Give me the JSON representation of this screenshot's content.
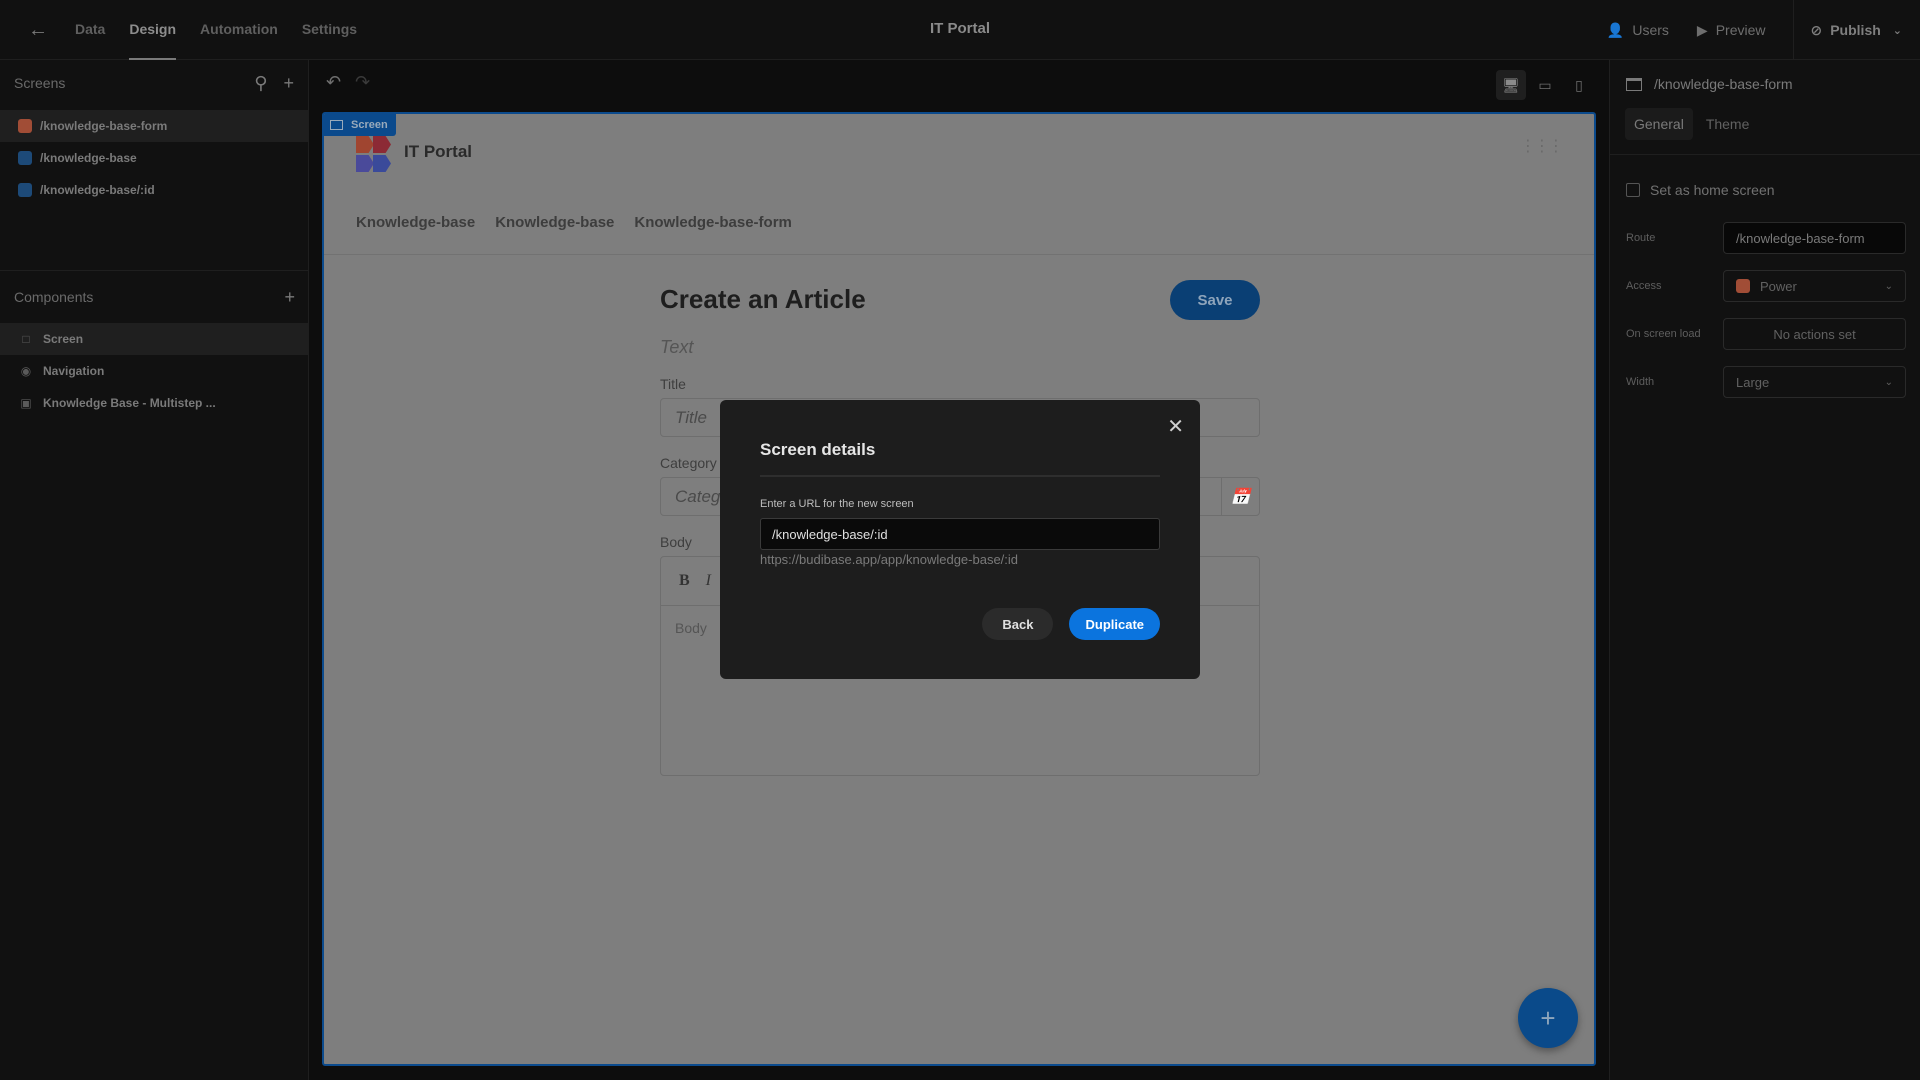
{
  "topbar": {
    "back_icon": "arrow-left-icon",
    "tabs": [
      {
        "label": "Data",
        "active": false
      },
      {
        "label": "Design",
        "active": true
      },
      {
        "label": "Automation",
        "active": false
      },
      {
        "label": "Settings",
        "active": false
      }
    ],
    "app_title": "IT Portal",
    "users_label": "Users",
    "preview_label": "Preview",
    "publish_label": "Publish"
  },
  "screens_panel": {
    "title": "Screens",
    "items": [
      {
        "route": "/knowledge-base-form",
        "color": "#a14d36",
        "selected": true
      },
      {
        "route": "/knowledge-base",
        "color": "#1d4a78",
        "selected": false
      },
      {
        "route": "/knowledge-base/:id",
        "color": "#1d4a78",
        "selected": false
      }
    ]
  },
  "components_panel": {
    "title": "Components",
    "items": [
      {
        "label": "Screen",
        "icon": "screen-icon",
        "selected": true
      },
      {
        "label": "Navigation",
        "icon": "eye-icon",
        "selected": false
      },
      {
        "label": "Knowledge Base - Multistep ...",
        "icon": "form-block-icon",
        "selected": false
      }
    ]
  },
  "canvas": {
    "screen_tag": "Screen",
    "app_name": "IT Portal",
    "nav_links": [
      "Knowledge-base",
      "Knowledge-base",
      "Knowledge-base-form"
    ],
    "form": {
      "title": "Create an Article",
      "save_label": "Save",
      "text_placeholder": "Text",
      "fields": [
        {
          "label": "Title",
          "placeholder": "Title"
        },
        {
          "label": "Category",
          "placeholder": "Category"
        }
      ],
      "body_label": "Body",
      "body_placeholder": "Body",
      "bold_label": "B",
      "italic_label": "I"
    }
  },
  "modal": {
    "title": "Screen details",
    "input_label": "Enter a URL for the new screen",
    "input_value": "/knowledge-base/:id",
    "url_preview": "https://budibase.app/app/knowledge-base/:id",
    "back_label": "Back",
    "duplicate_label": "Duplicate"
  },
  "settings_panel": {
    "screen_route": "/knowledge-base-form",
    "tabs": [
      {
        "label": "General",
        "active": true
      },
      {
        "label": "Theme",
        "active": false
      }
    ],
    "home_screen_label": "Set as home screen",
    "home_screen_checked": false,
    "route_label": "Route",
    "route_value": "/knowledge-base-form",
    "access_label": "Access",
    "access_value": "Power",
    "access_color": "#a14d36",
    "onload_label": "On screen load",
    "onload_value": "No actions set",
    "width_label": "Width",
    "width_value": "Large"
  }
}
